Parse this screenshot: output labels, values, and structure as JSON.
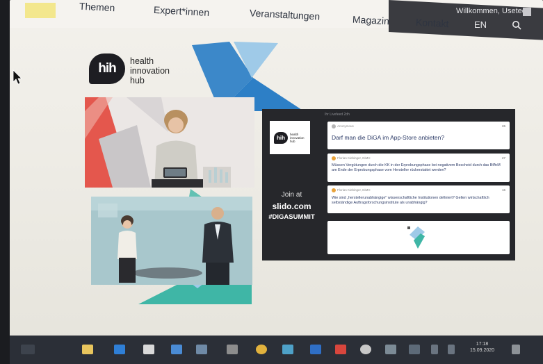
{
  "nav": {
    "items": [
      "Themen",
      "Expert*innen",
      "Veranstaltungen",
      "Magazin",
      "Kontakt"
    ],
    "user_greeting": "Willkommen, Usetee",
    "language": "EN"
  },
  "logo": {
    "badge": "hih",
    "lines": [
      "health",
      "innovation",
      "hub"
    ]
  },
  "slido": {
    "top_label": "Ihr Livefeed 2dh",
    "logo_badge": "hih",
    "logo_lines": [
      "health",
      "innovation",
      "hub"
    ],
    "join_line": "Join at",
    "join_url": "slido.com",
    "hashtag": "#DIGASUMMIT",
    "questions": [
      {
        "author": "Anonymous",
        "likes": "26",
        "text": "Darf man die DiGA im App-Store anbieten?"
      },
      {
        "author": "Florian Kiebinger, DiMH",
        "likes": "27",
        "text": "Müssen Vergütungen durch die KK in der Erprobungsphase bei negativem Bescheid durch das BfArM am Ende der Erprobungsphase vom Hersteller rückerstattet werden?"
      },
      {
        "author": "Florian Kiebinger, DiMH",
        "likes": "16",
        "text": "Wie sind „herstellerunabhängige\" wissenschaftliche Institutionen definiert? Gelten wirtschaftlich selbständige Auftragsforschungsinstitute als unabhängig?"
      }
    ]
  },
  "taskbar": {
    "time": "17:18",
    "date": "15.09.2020"
  },
  "colors": {
    "accent_blue": "#2d7fc6",
    "light_blue": "#9fcae8",
    "teal": "#3fb6a6",
    "coral": "#e4574d",
    "slido_bg": "#26272b"
  }
}
